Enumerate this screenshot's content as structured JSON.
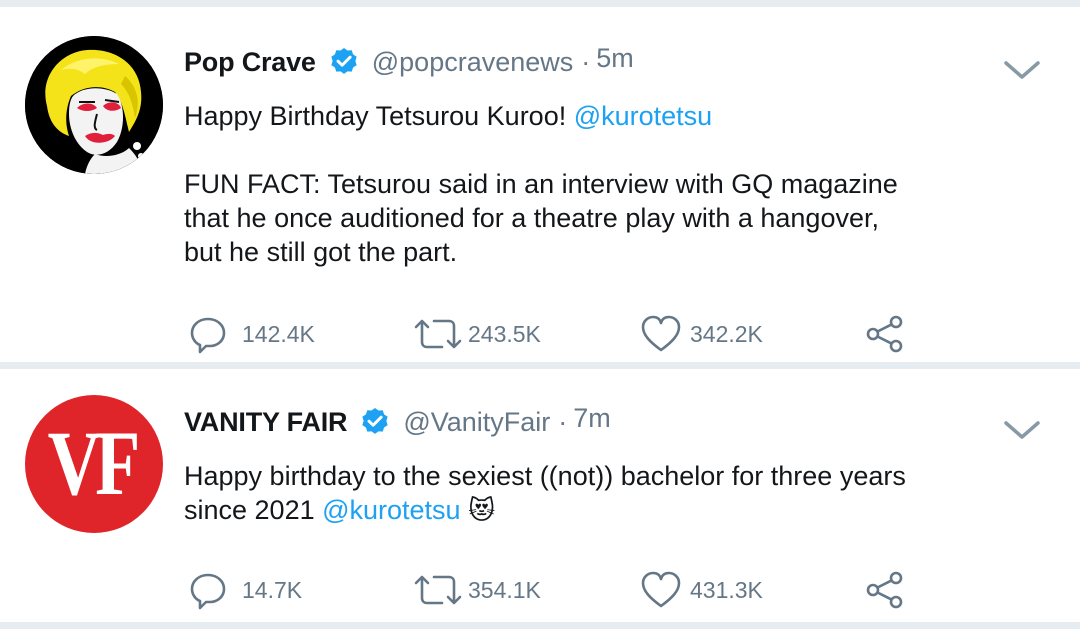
{
  "tweets": [
    {
      "author_name": "Pop Crave",
      "handle": "@popcravenews",
      "separator": "·",
      "time": "5m",
      "text_line1": "Happy Birthday Tetsurou Kuroo! ",
      "mention1": "@kurotetsu",
      "fact_lines": [
        "FUN FACT: Tetsurou said in an interview with GQ magazine",
        "that he once auditioned for a theatre play with a hangover,",
        "but he still got the part."
      ],
      "replies": "142.4K",
      "retweets": "243.5K",
      "likes": "342.2K"
    },
    {
      "author_name": "VANITY FAIR",
      "avatar_text": "VF",
      "handle": "@VanityFair",
      "separator": "·",
      "time": "7m",
      "text_line1": "Happy birthday to the sexiest ((not)) bachelor for three years",
      "text_line2_prefix": "since 2021 ",
      "mention1": "@kurotetsu",
      "emoji": "😻",
      "replies": "14.7K",
      "retweets": "354.1K",
      "likes": "431.3K"
    }
  ],
  "colors": {
    "link": "#1da1f2",
    "muted": "#657786",
    "divider": "#e6ecf0",
    "vf_red": "#e0252a",
    "verified": "#1da1f2"
  },
  "icons": [
    "verified-badge-icon",
    "chevron-down-icon",
    "reply-icon",
    "retweet-icon",
    "like-icon",
    "share-icon"
  ]
}
